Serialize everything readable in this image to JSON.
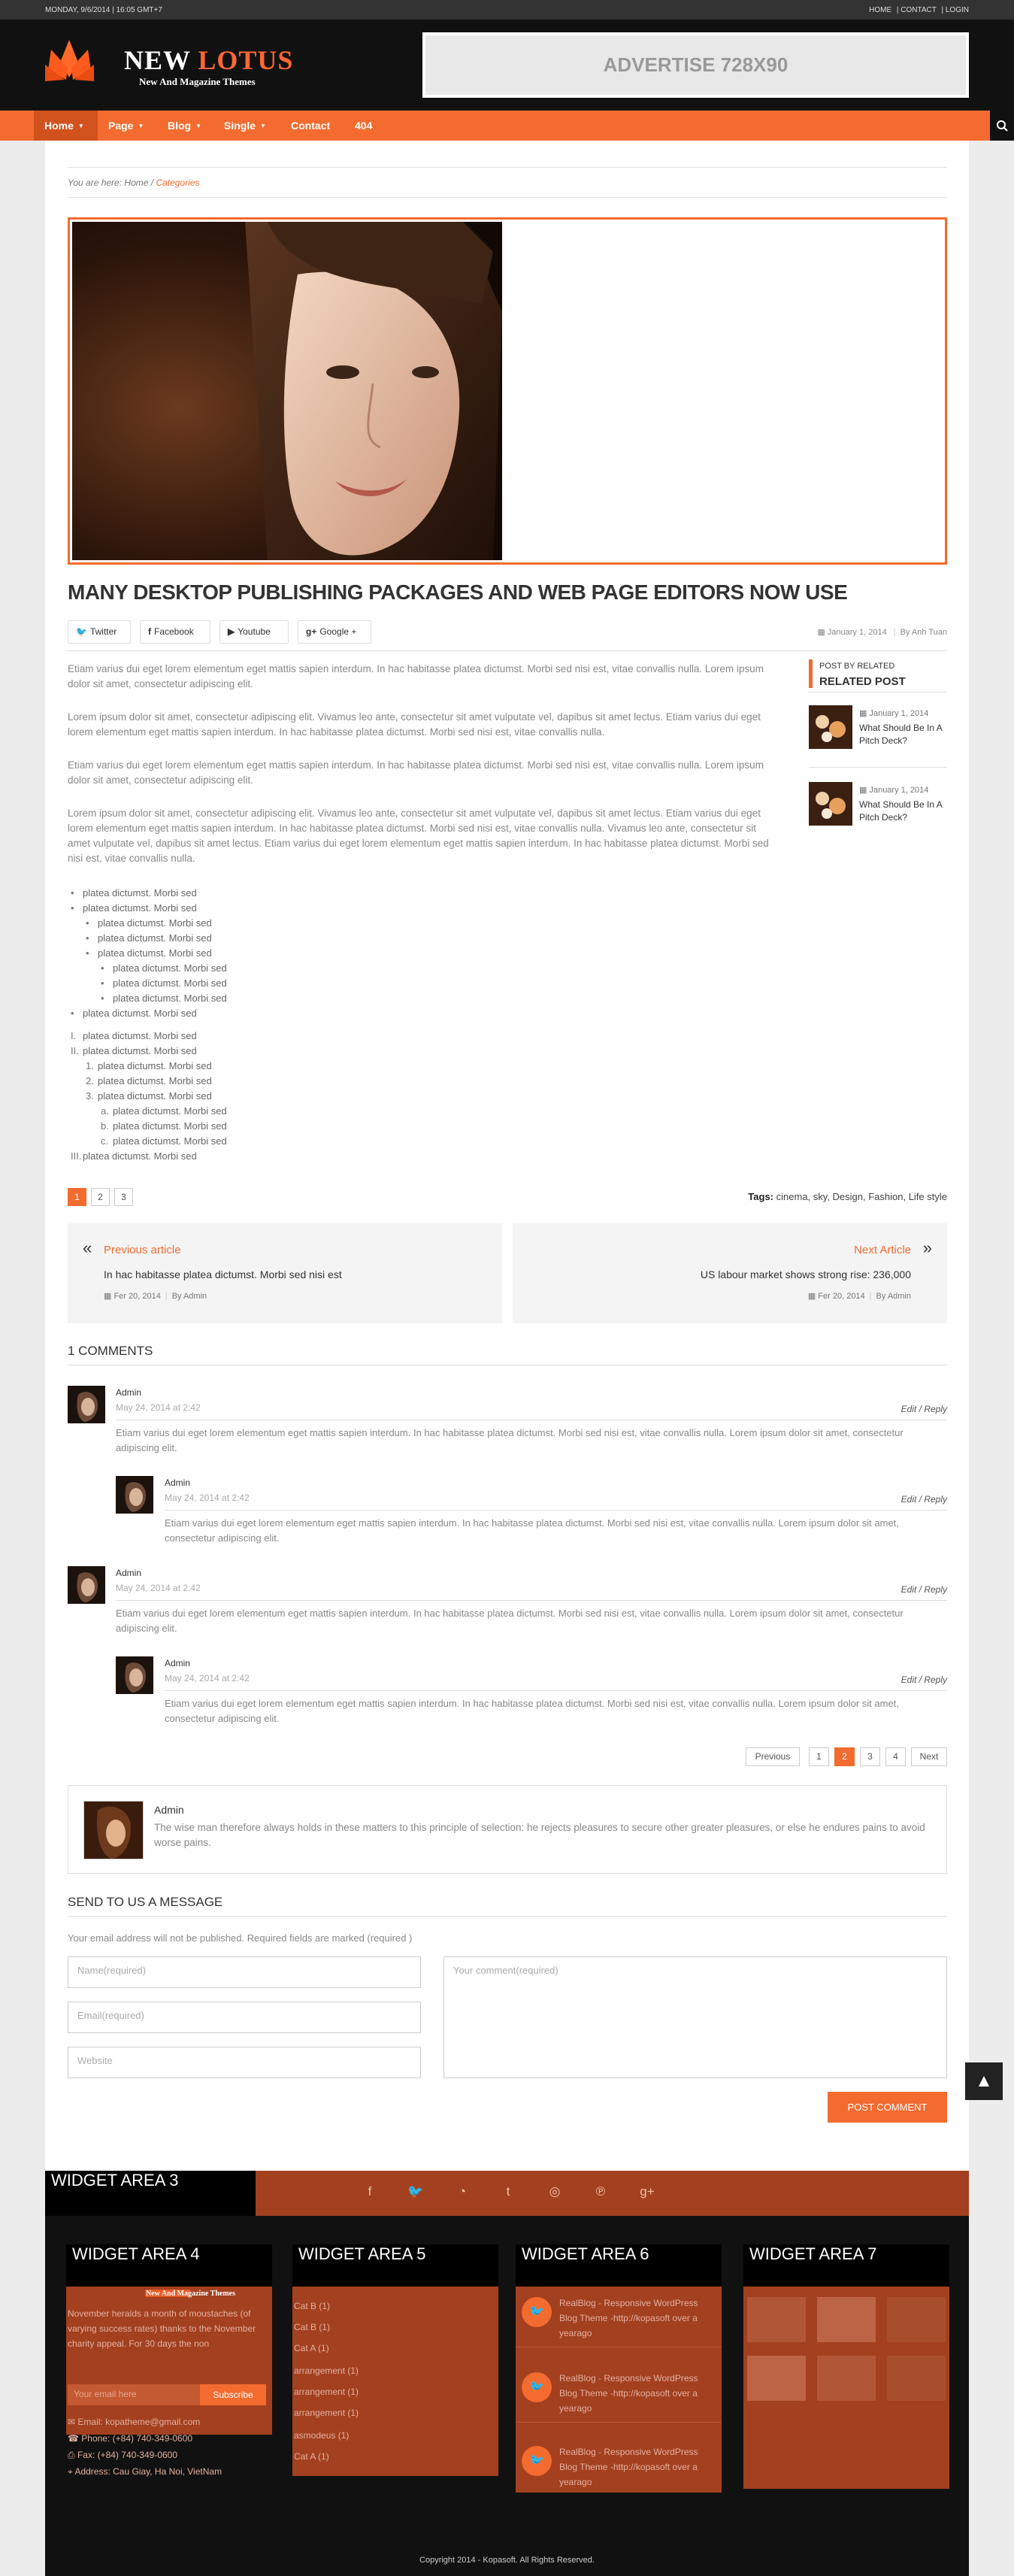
{
  "topbar": {
    "date": "MONDAY, 9/6/2014 | 16:05 GMT+7",
    "links": [
      "HOME",
      "|",
      "CONTACT",
      "|",
      "LOGIN"
    ]
  },
  "header": {
    "logo_word1": "NEW ",
    "logo_word2": "LOTUS",
    "tagline": "New And Magazine Themes",
    "banner": "ADVERTISE 728X90"
  },
  "nav": {
    "items": [
      "Home",
      "Page",
      "Blog",
      "Single",
      "Contact",
      "404"
    ]
  },
  "breadcrumb": {
    "prefix": "You are here:",
    "home": "Home",
    "sep": " / ",
    "current": "Categories"
  },
  "post": {
    "title": "MANY DESKTOP PUBLISHING PACKAGES AND WEB PAGE EDITORS NOW USE",
    "share": [
      "Twitter",
      "Facebook",
      "Youtube",
      "Google +"
    ],
    "date": "January 1, 2014",
    "author": "By Anh Tuan",
    "paragraphs": [
      "Etiam varius dui eget lorem elementum eget mattis sapien interdum. In hac habitasse platea dictumst. Morbi sed nisi est, vitae convallis nulla. Lorem ipsum dolor sit amet, consectetur adipiscing elit.",
      "Lorem ipsum dolor sit amet, consectetur adipiscing elit. Vivamus leo ante, consectetur sit amet vulputate vel, dapibus sit amet lectus. Etiam varius dui eget lorem elementum eget mattis sapien interdum. In hac habitasse platea dictumst. Morbi sed nisi est, vitae convallis nulla.",
      "Etiam varius dui eget lorem elementum eget mattis sapien interdum. In hac habitasse platea dictumst. Morbi sed nisi est, vitae convallis nulla. Lorem ipsum dolor sit amet, consectetur adipiscing elit.",
      "Lorem ipsum dolor sit amet, consectetur adipiscing elit. Vivamus leo ante, consectetur sit amet vulputate vel, dapibus sit amet lectus. Etiam varius dui eget lorem elementum eget mattis sapien interdum. In hac habitasse platea dictumst. Morbi sed nisi est, vitae convallis nulla. Vivamus leo ante, consectetur sit amet vulputate vel, dapibus sit amet lectus. Etiam varius dui eget lorem elementum eget mattis sapien interdum. In hac habitasse platea dictumst. Morbi sed nisi est, vitae convallis nulla."
    ],
    "list_item": "platea dictumst. Morbi sed",
    "ul_bullets": [
      "•",
      "•",
      "•",
      "•",
      "•",
      "•",
      "•",
      "•",
      "•"
    ],
    "ol_bullets": [
      "I.",
      "II.",
      "1.",
      "2.",
      "3.",
      "a.",
      "b.",
      "c.",
      "III."
    ],
    "pages": [
      "1",
      "2",
      "3"
    ],
    "tags_label": "Tags:",
    "tags": "cinema, sky, Design, Fashion, Life style"
  },
  "related": {
    "small": "POST BY RELATED",
    "big": "RELATED POST",
    "items": [
      {
        "date": "January 1, 2014",
        "title": "What Should Be In A Pitch Deck?"
      },
      {
        "date": "January 1, 2014",
        "title": "What Should Be In A Pitch Deck?"
      }
    ]
  },
  "prevnext": {
    "prev_label": "Previous article",
    "prev_title": "In hac habitasse platea dictumst. Morbi sed nisi est",
    "prev_date": "Fer 20, 2014",
    "prev_by": "By Admin",
    "next_label": "Next Article",
    "next_title": "US labour market shows strong rise: 236,000",
    "next_date": "Fer 20, 2014",
    "next_by": "By Admin"
  },
  "comments": {
    "heading": "1 COMMENTS",
    "name": "Admin",
    "date": "May 24, 2014 at 2:42",
    "actions": "Edit / Reply",
    "text": "Etiam varius dui eget lorem elementum eget mattis sapien interdum. In hac habitasse platea dictumst. Morbi sed nisi est, vitae convallis nulla. Lorem ipsum dolor sit amet, consectetur adipiscing elit.",
    "pagination": [
      "Previous",
      "1",
      "2",
      "3",
      "4",
      "Next"
    ]
  },
  "author_box": {
    "name": "Admin",
    "bio": "The wise man therefore always holds in these matters to this principle of selection: he rejects pleasures to secure other greater pleasures, or else he endures pains to avoid worse pains."
  },
  "form": {
    "heading": "SEND TO US A MESSAGE",
    "note": "Your email address will not be published. Required fields are marked (required )",
    "name_ph": "Name(required)",
    "email_ph": "Email(required)",
    "website_ph": "Website",
    "comment_ph": "Your comment(required)",
    "submit": "POST COMMENT"
  },
  "footer": {
    "widget3": "WIDGET AREA 3",
    "widget4": {
      "title": "WIDGET AREA 4",
      "tagline": "New And Magazine Themes",
      "text": "November heralds a month of moustaches (of varying success rates) thanks to the November charity appeal. For 30 days the non",
      "email_ph": "Your email here",
      "subscribe": "Subscribe",
      "contacts": [
        "Email: kopatheme@gmail.com",
        "Phone: (+84) 740-349-0600",
        "Fax: (+84) 740-349-0600",
        "Address: Cau Giay, Ha Noi, VietNam"
      ]
    },
    "widget5": {
      "title": "WIDGET AREA 5",
      "items": [
        "Cat B (1)",
        "Cat B (1)",
        "Cat A (1)",
        "arrangement (1)",
        "arrangement (1)",
        "arrangement (1)",
        "asmodeus (1)",
        "Cat A (1)"
      ]
    },
    "widget6": {
      "title": "WIDGET AREA 6",
      "tweet": "RealBlog - Responsive WordPress Blog Theme -http://kopasoft over a yearago"
    },
    "widget7": {
      "title": "WIDGET AREA 7"
    },
    "copyright": "Copyright 2014 - Kopasoft. All Rights Reserved."
  }
}
